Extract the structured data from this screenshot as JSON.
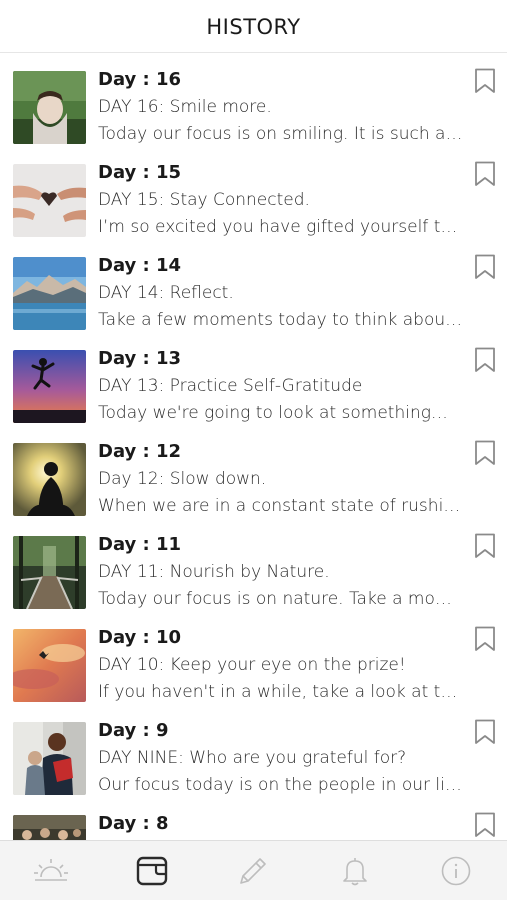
{
  "header": {
    "title": "HISTORY"
  },
  "entries": [
    {
      "day": "Day : 16",
      "title": "DAY 16: Smile more.",
      "excerpt": "Today our focus is on smiling. It is such a simple act…",
      "thumb": "smiling-woman-photo"
    },
    {
      "day": "Day : 15",
      "title": "DAY 15: Stay Connected.",
      "excerpt": "I’m so excited you have gifted yourself this time…",
      "thumb": "hands-heart-photo"
    },
    {
      "day": "Day : 14",
      "title": "DAY 14: Reflect.",
      "excerpt": "Take a few moments today to think about…",
      "thumb": "mountain-lake-photo"
    },
    {
      "day": "Day : 13",
      "title": "DAY 13: Practice Self-Gratitude",
      "excerpt": "Today we're going to look at something…",
      "thumb": "jumping-sunset-photo"
    },
    {
      "day": "Day : 12",
      "title": "Day 12: Slow down.",
      "excerpt": "When we are in a constant state of rushing…",
      "thumb": "meditating-silhouette-photo"
    },
    {
      "day": "Day : 11",
      "title": "DAY 11: Nourish by Nature.",
      "excerpt": "Today our focus is on nature. Take a moment…",
      "thumb": "forest-bridge-photo"
    },
    {
      "day": "Day : 10",
      "title": "DAY 10: Keep your eye on the prize!",
      "excerpt": "If you haven't in a while, take a look at the…",
      "thumb": "sunset-clouds-bird-photo"
    },
    {
      "day": "Day : 9",
      "title": "DAY NINE: Who are you grateful for?",
      "excerpt": "Our focus today is on the people in our lives…",
      "thumb": "mother-child-photo"
    },
    {
      "day": "Day : 8",
      "title": "",
      "excerpt": "",
      "thumb": "group-photo"
    }
  ],
  "tabs": [
    {
      "icon": "sunrise-icon",
      "active": false
    },
    {
      "icon": "journal-icon",
      "active": true
    },
    {
      "icon": "pencil-icon",
      "active": false
    },
    {
      "icon": "bell-icon",
      "active": false
    },
    {
      "icon": "info-icon",
      "active": false
    }
  ],
  "colors": {
    "active_tab": "#2b2b2b",
    "inactive_tab": "#bdbdbd",
    "tabbar_bg": "#f4f4f4"
  }
}
